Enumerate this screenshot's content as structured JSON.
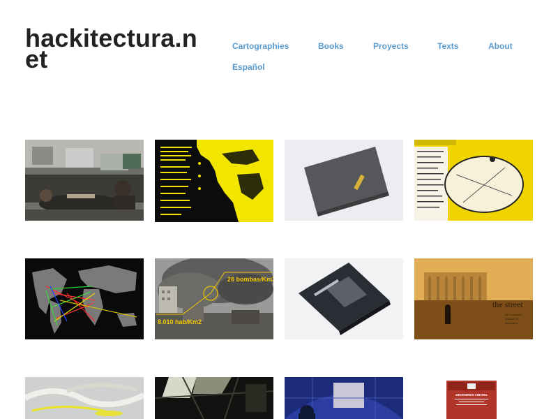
{
  "site": {
    "title": "hackitectura.net"
  },
  "nav": {
    "items": [
      {
        "label": "Cartographies"
      },
      {
        "label": "Books"
      },
      {
        "label": "Proyects"
      },
      {
        "label": "Texts"
      },
      {
        "label": "About"
      },
      {
        "label": "Español"
      }
    ]
  },
  "gallery": {
    "thumbs": [
      {
        "name": "photo-workshop-room"
      },
      {
        "name": "map-africa-yellow-black"
      },
      {
        "name": "book-grey-cover"
      },
      {
        "name": "map-circular-yellow"
      },
      {
        "name": "world-map-network-lines"
      },
      {
        "name": "smoke-city-bombing",
        "texts": [
          "28 bombas/Km2",
          "8.010 hab/Km2"
        ]
      },
      {
        "name": "book-dark-cover"
      },
      {
        "name": "the-street-poster",
        "texts": [
          "the street",
          "as a common",
          "patterns of",
          "repression"
        ]
      },
      {
        "name": "light-sculpture"
      },
      {
        "name": "dark-dome-interior"
      },
      {
        "name": "dome-projection"
      },
      {
        "name": "red-book-cover",
        "texts": [
          "DEVENIRES CIBORG"
        ]
      }
    ]
  }
}
